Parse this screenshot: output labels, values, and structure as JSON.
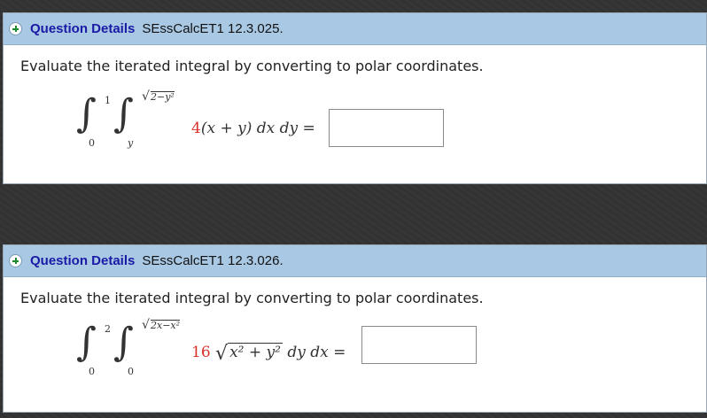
{
  "questions": [
    {
      "header_title": "Question Details",
      "header_code": "SEssCalcET1 12.3.025.",
      "prompt": "Evaluate the iterated integral by converting to polar coordinates.",
      "outer_lower": "0",
      "outer_upper": "1",
      "inner_lower": "y",
      "inner_upper_root": "2−y²",
      "coefficient": "4",
      "integrand_rest": "(x + y) dx dy =",
      "answer_value": ""
    },
    {
      "header_title": "Question Details",
      "header_code": "SEssCalcET1 12.3.026.",
      "prompt": "Evaluate the iterated integral by converting to polar coordinates.",
      "outer_lower": "0",
      "outer_upper": "2",
      "inner_lower": "0",
      "inner_upper_root": "2x−x²",
      "coefficient": "16",
      "integrand_root": "x² + y²",
      "integrand_rest": "dy dx =",
      "answer_value": ""
    }
  ],
  "colors": {
    "header_bg": "#a9c8e3",
    "header_title": "#1a1aa6",
    "plus_icon": "#1d8a2e",
    "coefficient": "#d9322b",
    "page_bg": "#333333"
  },
  "icons": {
    "expand": "plus-icon"
  }
}
